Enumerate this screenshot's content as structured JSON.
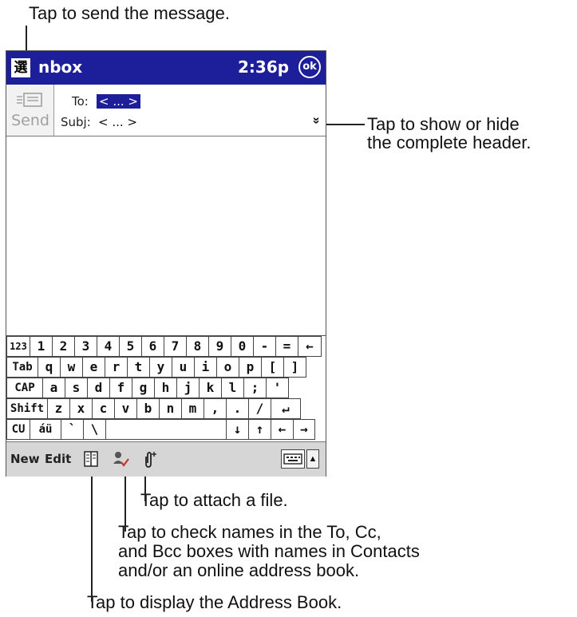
{
  "callouts": {
    "send": "Tap to send the message.",
    "header_line1": "Tap to show or hide",
    "header_line2": "the complete header.",
    "attach": "Tap to attach a file.",
    "check_line1": "Tap to check names in the To, Cc,",
    "check_line2": "and Bcc boxes with names in Contacts",
    "check_line3": "and/or an online address book.",
    "address": "Tap to display the Address Book."
  },
  "titlebar": {
    "title": "nbox",
    "time": "2:36p",
    "ok_label": "ok",
    "start_glyph": "選"
  },
  "header": {
    "send_label": "Send",
    "to_label": "To:",
    "to_value": "< ... >",
    "subj_label": "Subj:",
    "subj_value": "< ... >",
    "toggle_glyph": "»"
  },
  "keyboard": {
    "rows": [
      [
        "123",
        "1",
        "2",
        "3",
        "4",
        "5",
        "6",
        "7",
        "8",
        "9",
        "0",
        "-",
        "=",
        "←"
      ],
      [
        "Tab",
        "q",
        "w",
        "e",
        "r",
        "t",
        "y",
        "u",
        "i",
        "o",
        "p",
        "[",
        "]"
      ],
      [
        "CAP",
        "a",
        "s",
        "d",
        "f",
        "g",
        "h",
        "j",
        "k",
        "l",
        ";",
        "'"
      ],
      [
        "Shift",
        "z",
        "x",
        "c",
        "v",
        "b",
        "n",
        "m",
        ",",
        ".",
        "/",
        "↵"
      ],
      [
        "CU",
        "áü",
        "`",
        "\\",
        "",
        "↓",
        "↑",
        "←",
        "→"
      ]
    ]
  },
  "menubar": {
    "new_label": "New",
    "edit_label": "Edit",
    "icons": [
      "address-book-icon",
      "check-names-icon",
      "attach-icon",
      "keyboard-icon"
    ]
  },
  "colors": {
    "titlebar": "#1d1f9a",
    "menubar": "#d6d6d6"
  }
}
